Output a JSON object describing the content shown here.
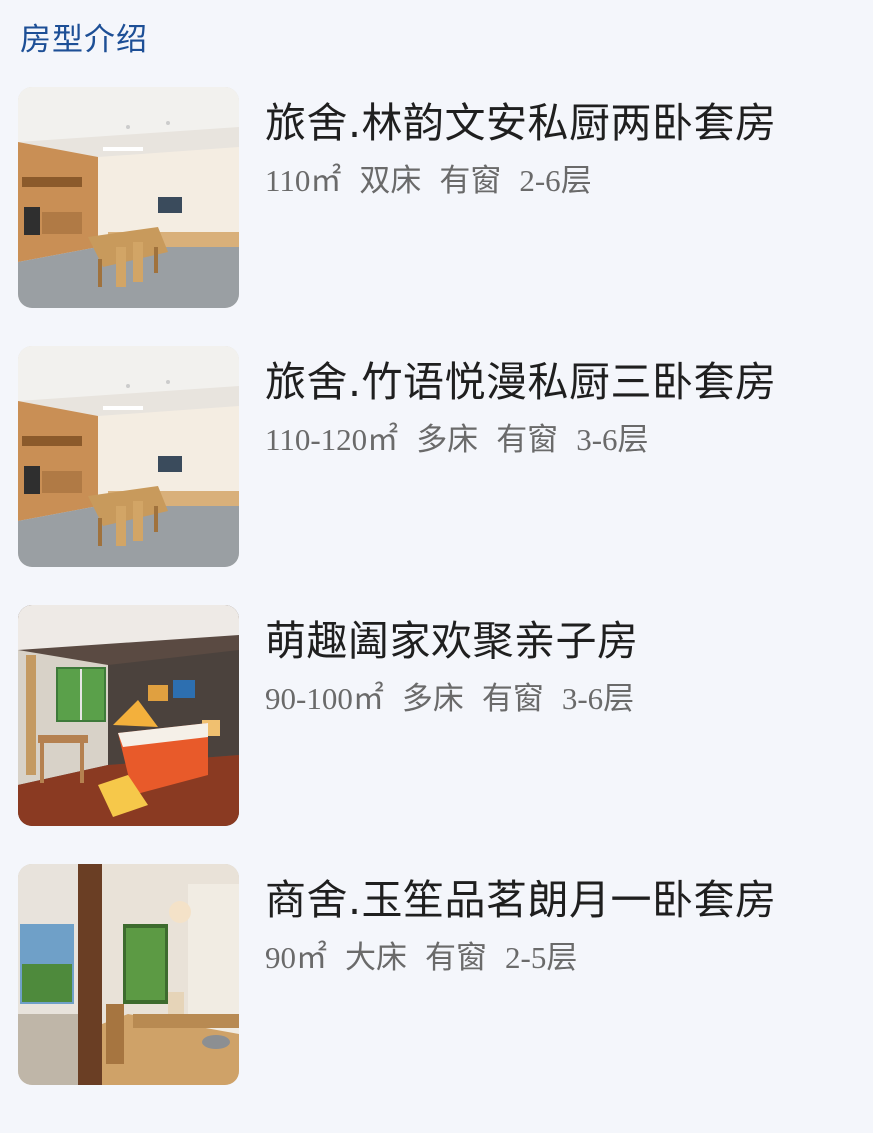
{
  "section": {
    "title": "房型介绍"
  },
  "rooms": [
    {
      "name": "旅舍.林韵文安私厨两卧套房",
      "area": "110㎡",
      "bed": "双床",
      "window": "有窗",
      "floors": "2-6",
      "floor_unit": "层",
      "image_icon": "kitchen-dining-photo"
    },
    {
      "name": "旅舍.竹语悦漫私厨三卧套房",
      "area": "110-120㎡",
      "bed": "多床",
      "window": "有窗",
      "floors": "3-6",
      "floor_unit": "层",
      "image_icon": "kitchen-dining-photo"
    },
    {
      "name": "萌趣阖家欢聚亲子房",
      "area": "90-100㎡",
      "bed": "多床",
      "window": "有窗",
      "floors": "3-6",
      "floor_unit": "层",
      "image_icon": "family-bedroom-photo"
    },
    {
      "name": "商舍.玉笙品茗朗月一卧套房",
      "area": "90㎡",
      "bed": "大床",
      "window": "有窗",
      "floors": "2-5",
      "floor_unit": "层",
      "image_icon": "suite-lounge-photo"
    }
  ],
  "colors": {
    "background": "#f4f6fb",
    "title": "#1d4f96",
    "room_name": "#1f1f1f",
    "specs": "#6a6a6a"
  }
}
